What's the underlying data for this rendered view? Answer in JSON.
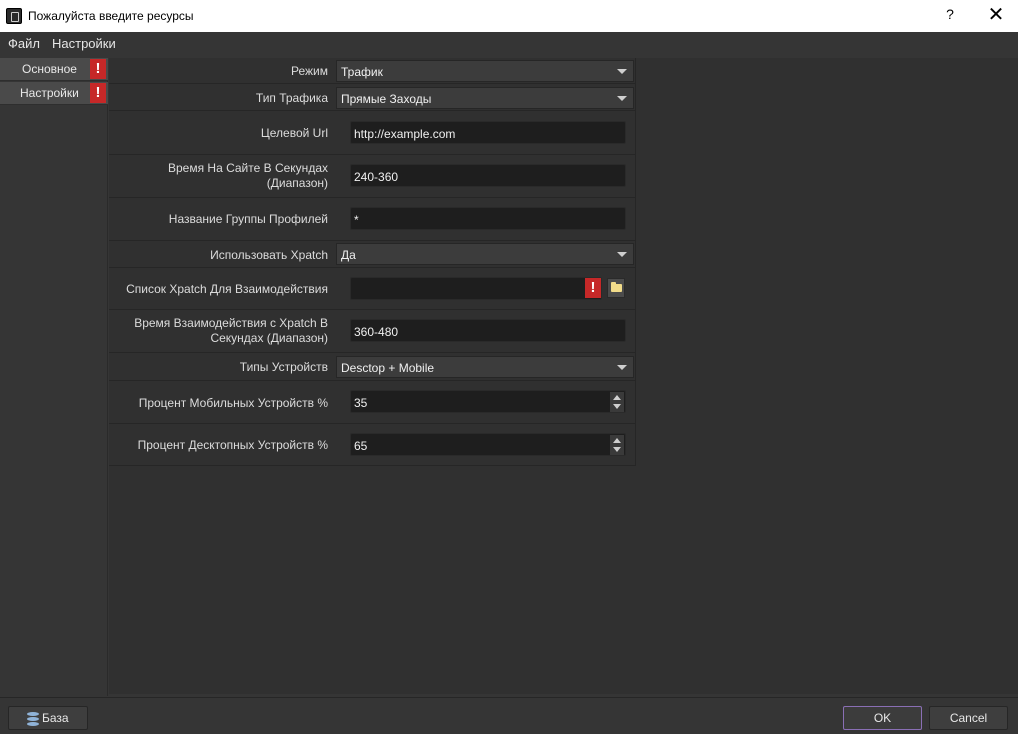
{
  "window": {
    "title": "Пожалуйста введите ресурсы",
    "help_glyph": "?",
    "close_glyph": "✕"
  },
  "menubar": {
    "file": "Файл",
    "settings": "Настройки"
  },
  "sidebar": {
    "tabs": [
      {
        "label": "Основное",
        "warning": "!"
      },
      {
        "label": "Настройки",
        "warning": "!"
      }
    ]
  },
  "form": {
    "mode": {
      "label": "Режим",
      "value": "Трафик"
    },
    "traffic_type": {
      "label": "Тип Трафика",
      "value": "Прямые Заходы"
    },
    "target_url": {
      "label": "Целевой Url",
      "value": "http://example.com"
    },
    "time_on_site": {
      "label": "Время На Сайте В Секундах (Диапазон)",
      "value": "240-360"
    },
    "profile_group": {
      "label": "Название Группы Профилей",
      "value": "*"
    },
    "use_xpatch": {
      "label": "Использовать Xpatch",
      "value": "Да"
    },
    "xpatch_list": {
      "label": "Список Xpatch Для Взаимодействия",
      "value": "",
      "warning": "!"
    },
    "xpatch_time": {
      "label": "Время Взаимодействия с Xpatch В Секундах (Диапазон)",
      "value": "360-480"
    },
    "device_types": {
      "label": "Типы Устройств",
      "value": "Desctop + Mobile"
    },
    "mobile_percent": {
      "label": "Процент Мобильных Устройств %",
      "value": "35"
    },
    "desktop_percent": {
      "label": "Процент Десктопных Устройств %",
      "value": "65"
    }
  },
  "bottombar": {
    "database_label": "База",
    "ok_label": "OK",
    "cancel_label": "Cancel"
  }
}
